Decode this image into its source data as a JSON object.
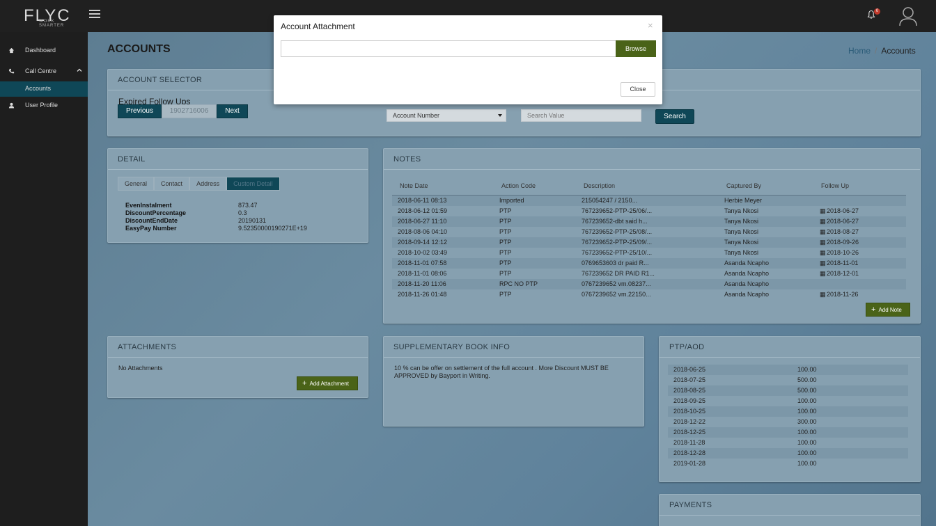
{
  "header": {
    "logo": "FLYC",
    "logo_tagline": "WORK SMARTER",
    "notification_count": "0"
  },
  "sidebar": {
    "items": [
      {
        "label": "Dashboard"
      },
      {
        "label": "Call Centre"
      },
      {
        "label": "Accounts"
      },
      {
        "label": "User Profile"
      }
    ]
  },
  "page": {
    "title": "ACCOUNTS",
    "breadcrumb_home": "Home",
    "breadcrumb_sep": "/",
    "breadcrumb_current": "Accounts"
  },
  "account_selector": {
    "title": "ACCOUNT SELECTOR",
    "subtitle": "Expired Follow Ups",
    "prev_label": "Previous",
    "account_value": "1902716006",
    "next_label": "Next",
    "search_field": "Account Number",
    "search_placeholder": "Search Value",
    "search_label": "Search"
  },
  "detail": {
    "title": "DETAIL",
    "tabs": [
      "General",
      "Contact",
      "Address",
      "Custom Detail"
    ],
    "fields": [
      {
        "key": "EvenInstalment",
        "value": "873.47"
      },
      {
        "key": "DiscountPercentage",
        "value": "0.3"
      },
      {
        "key": "DiscountEndDate",
        "value": "20190131"
      },
      {
        "key": "EasyPay Number",
        "value": "9.52350000190271E+19"
      }
    ]
  },
  "notes": {
    "title": "NOTES",
    "columns": [
      "Note Date",
      "Action Code",
      "Description",
      "Captured By",
      "Follow Up"
    ],
    "rows": [
      {
        "date": "2018-06-11 08:13",
        "code": "Imported",
        "desc": "215054247 / 2150...",
        "by": "Herbie Meyer",
        "follow": ""
      },
      {
        "date": "2018-06-12 01:59",
        "code": "PTP",
        "desc": "767239652-PTP-25/06/...",
        "by": "Tanya Nkosi",
        "follow": "2018-06-27"
      },
      {
        "date": "2018-06-27 11:10",
        "code": "PTP",
        "desc": "767239652-dbt said h...",
        "by": "Tanya Nkosi",
        "follow": "2018-06-27"
      },
      {
        "date": "2018-08-06 04:10",
        "code": "PTP",
        "desc": "767239652-PTP-25/08/...",
        "by": "Tanya Nkosi",
        "follow": "2018-08-27"
      },
      {
        "date": "2018-09-14 12:12",
        "code": "PTP",
        "desc": "767239652-PTP-25/09/...",
        "by": "Tanya Nkosi",
        "follow": "2018-09-26"
      },
      {
        "date": "2018-10-02 03:49",
        "code": "PTP",
        "desc": "767239652-PTP-25/10/...",
        "by": "Tanya Nkosi",
        "follow": "2018-10-26"
      },
      {
        "date": "2018-11-01 07:58",
        "code": "PTP",
        "desc": "0769653603 dr paid R...",
        "by": "Asanda Ncapho",
        "follow": "2018-11-01"
      },
      {
        "date": "2018-11-01 08:06",
        "code": "PTP",
        "desc": "767239652 DR PAID R1...",
        "by": "Asanda Ncapho",
        "follow": "2018-12-01"
      },
      {
        "date": "2018-11-20 11:06",
        "code": "RPC NO PTP",
        "desc": "0767239652 vm.08237...",
        "by": "Asanda Ncapho",
        "follow": ""
      },
      {
        "date": "2018-11-26 01:48",
        "code": "PTP",
        "desc": "0767239652 vm.22150...",
        "by": "Asanda Ncapho",
        "follow": "2018-11-26"
      }
    ],
    "add_label": "Add Note"
  },
  "attachments": {
    "title": "ATTACHMENTS",
    "empty_text": "No Attachments",
    "add_label": "Add Attachment"
  },
  "supplementary": {
    "title": "SUPPLEMENTARY BOOK INFO",
    "text": "10 % can be offer on settlement of the full account . More Discount MUST BE APPROVED by Bayport in Writing."
  },
  "ptp": {
    "title": "PTP/AOD",
    "rows": [
      {
        "date": "2018-06-25",
        "amount": "100.00"
      },
      {
        "date": "2018-07-25",
        "amount": "500.00"
      },
      {
        "date": "2018-08-25",
        "amount": "500.00"
      },
      {
        "date": "2018-09-25",
        "amount": "100.00"
      },
      {
        "date": "2018-10-25",
        "amount": "100.00"
      },
      {
        "date": "2018-12-22",
        "amount": "300.00"
      },
      {
        "date": "2018-12-25",
        "amount": "100.00"
      },
      {
        "date": "2018-11-28",
        "amount": "100.00"
      },
      {
        "date": "2018-12-28",
        "amount": "100.00"
      },
      {
        "date": "2019-01-28",
        "amount": "100.00"
      }
    ]
  },
  "payments": {
    "title": "PAYMENTS"
  },
  "modal": {
    "title": "Account Attachment",
    "close_x": "×",
    "browse_label": "Browse",
    "close_label": "Close"
  },
  "colors": {
    "accent_teal": "#0f4757",
    "accent_green": "#4a6318",
    "overlay": "#5f829b"
  }
}
